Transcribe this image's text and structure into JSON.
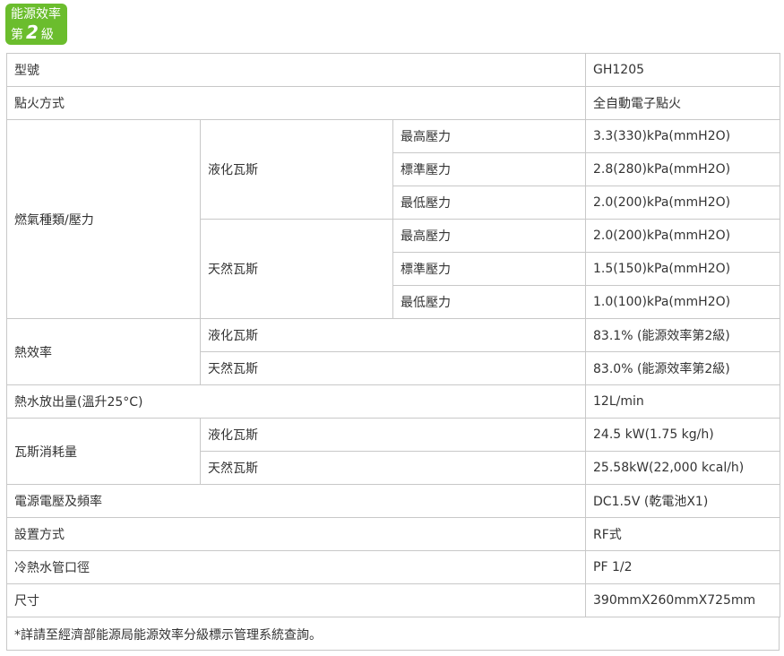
{
  "badge": {
    "line1": "能源效率",
    "prefix": "第",
    "level": "2",
    "suffix": "級"
  },
  "rows": {
    "model": {
      "label": "型號",
      "value": "GH1205"
    },
    "ignition": {
      "label": "點火方式",
      "value": "全自動電子點火"
    },
    "gas": {
      "label": "燃氣種類/壓力",
      "lpg": {
        "name": "液化瓦斯",
        "max": {
          "label": "最高壓力",
          "value": "3.3(330)kPa(mmH2O)"
        },
        "std": {
          "label": "標準壓力",
          "value": "2.8(280)kPa(mmH2O)"
        },
        "min": {
          "label": "最低壓力",
          "value": "2.0(200)kPa(mmH2O)"
        }
      },
      "ng": {
        "name": "天然瓦斯",
        "max": {
          "label": "最高壓力",
          "value": "2.0(200)kPa(mmH2O)"
        },
        "std": {
          "label": "標準壓力",
          "value": "1.5(150)kPa(mmH2O)"
        },
        "min": {
          "label": "最低壓力",
          "value": "1.0(100)kPa(mmH2O)"
        }
      }
    },
    "efficiency": {
      "label": "熱效率",
      "lpg": {
        "name": "液化瓦斯",
        "value": "83.1%  (能源效率第2級)"
      },
      "ng": {
        "name": "天然瓦斯",
        "value": "83.0%  (能源效率第2級)"
      }
    },
    "output": {
      "label": "熱水放出量(溫升25°C)",
      "value": "12L/min"
    },
    "consumption": {
      "label": "瓦斯消耗量",
      "lpg": {
        "name": "液化瓦斯",
        "value": "24.5 kW(1.75 kg/h)"
      },
      "ng": {
        "name": "天然瓦斯",
        "value": "25.58kW(22,000 kcal/h)"
      }
    },
    "power": {
      "label": "電源電壓及頻率",
      "value": "DC1.5V (乾電池X1)"
    },
    "install": {
      "label": "設置方式",
      "value": "RF式"
    },
    "pipe": {
      "label": "冷熱水管口徑",
      "value": "PF 1/2"
    },
    "size": {
      "label": "尺寸",
      "value": "390mmX260mmX725mm"
    }
  },
  "note": "*詳請至經濟部能源局能源效率分級標示管理系統查詢。"
}
